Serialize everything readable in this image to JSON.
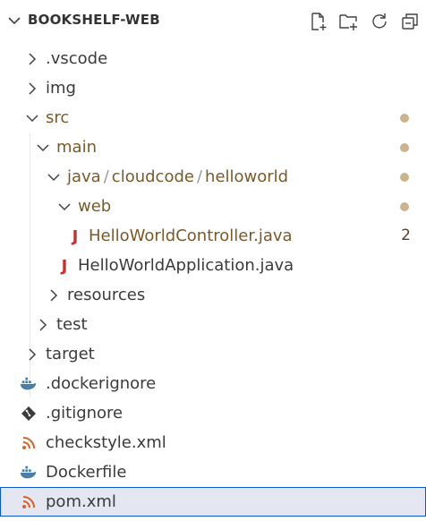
{
  "header": {
    "title": "BOOKSHELF-WEB"
  },
  "tree": {
    "vscode": ".vscode",
    "img": "img",
    "src": "src",
    "main": "main",
    "java_path": {
      "part1": "java",
      "part2": "cloudcode",
      "part3": "helloworld",
      "separator": "/"
    },
    "web": "web",
    "controller": "HelloWorldController.java",
    "controller_badge": "2",
    "application": "HelloWorldApplication.java",
    "resources": "resources",
    "test": "test",
    "target": "target",
    "dockerignore": ".dockerignore",
    "gitignore": ".gitignore",
    "checkstyle": "checkstyle.xml",
    "dockerfile": "Dockerfile",
    "pom": "pom.xml"
  },
  "icons": {
    "java": "J"
  },
  "colors": {
    "modified_dot": "#c9b48f",
    "java_icon": "#c9302c",
    "docker_icon": "#4a7ea8",
    "xml_icon": "#d4622a",
    "selection_border": "#0b57d0"
  }
}
